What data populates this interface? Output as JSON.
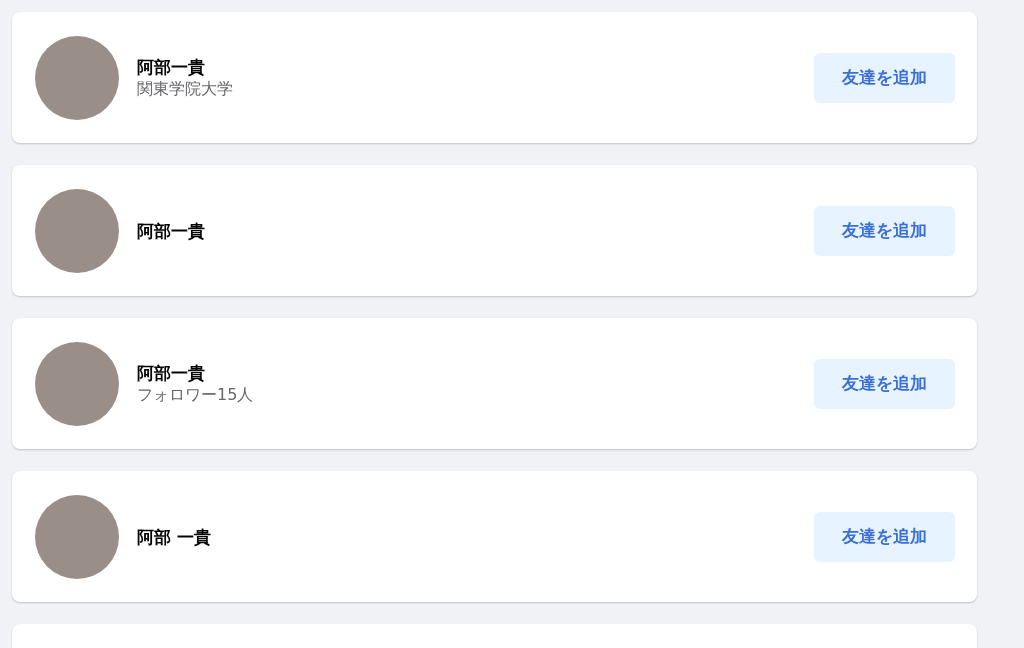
{
  "people": [
    {
      "name": "阿部一貴",
      "subtitle": "関東学院大学",
      "button": "友達を追加"
    },
    {
      "name": "阿部一貴",
      "button": "友達を追加"
    },
    {
      "name": "阿部一貴",
      "subtitle": "フォロワー15人",
      "button": "友達を追加"
    },
    {
      "name": "阿部 一貴",
      "button": "友達を追加"
    }
  ]
}
